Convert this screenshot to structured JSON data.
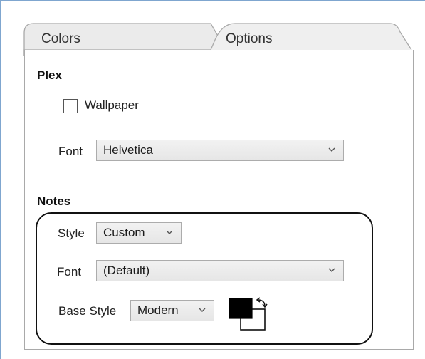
{
  "tabs": [
    {
      "label": "Colors",
      "active": false
    },
    {
      "label": "Options",
      "active": true
    }
  ],
  "plex": {
    "title": "Plex",
    "wallpaper_label": "Wallpaper",
    "wallpaper_checked": false,
    "font_label": "Font",
    "font_value": "Helvetica"
  },
  "notes": {
    "title": "Notes",
    "style_label": "Style",
    "style_value": "Custom",
    "font_label": "Font",
    "font_value": "(Default)",
    "base_style_label": "Base Style",
    "base_style_value": "Modern"
  },
  "colors": {
    "foreground": "#000000",
    "background": "#ffffff",
    "frame": "#7fa6cf"
  },
  "icons": {
    "dropdown": "chevron-down-icon",
    "swap": "swap-arrow-icon"
  }
}
